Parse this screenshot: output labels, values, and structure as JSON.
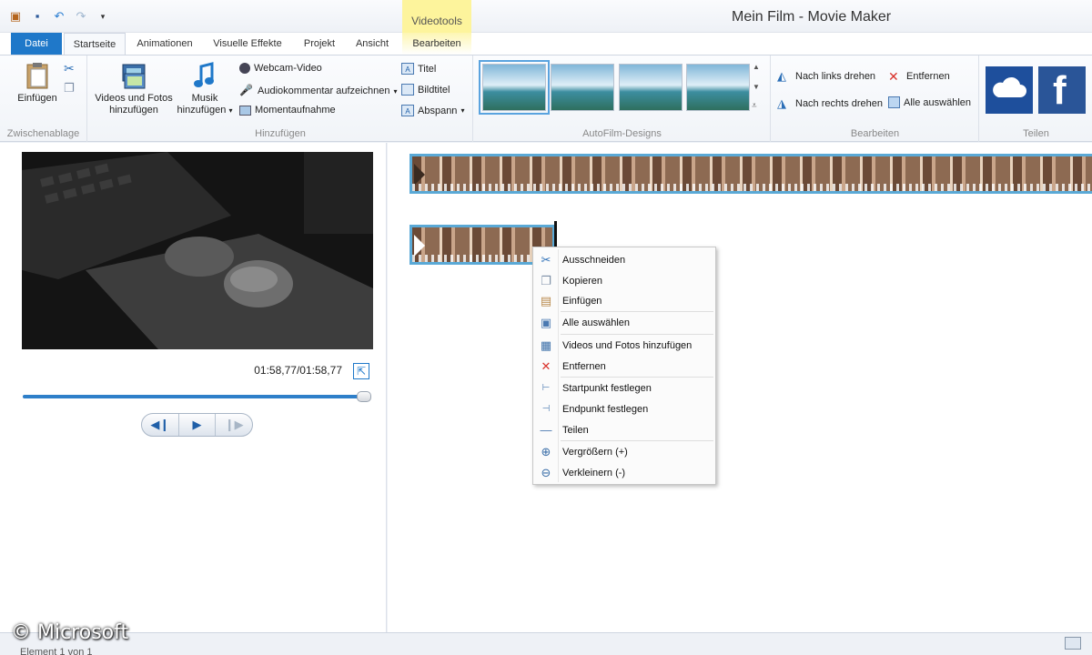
{
  "window": {
    "title": "Mein Film - Movie Maker",
    "context_group": "Videotools"
  },
  "tabs": [
    "Datei",
    "Startseite",
    "Animationen",
    "Visuelle Effekte",
    "Projekt",
    "Ansicht",
    "Bearbeiten"
  ],
  "ribbon": {
    "clipboard": {
      "paste": "Einfügen",
      "label": "Zwischenablage"
    },
    "add": {
      "videos_photos": [
        "Videos und Fotos",
        "hinzufügen"
      ],
      "music": [
        "Musik",
        "hinzufügen"
      ],
      "webcam": "Webcam-Video",
      "narration": "Audiokommentar aufzeichnen",
      "snapshot": "Momentaufnahme",
      "title": "Titel",
      "caption": "Bildtitel",
      "credits": "Abspann",
      "label": "Hinzufügen"
    },
    "themes": {
      "label": "AutoFilm-Designs"
    },
    "edit": {
      "rotate_left": "Nach links drehen",
      "rotate_right": "Nach rechts drehen",
      "remove": "Entfernen",
      "select_all": "Alle auswählen",
      "label": "Bearbeiten"
    },
    "share": {
      "label": "Teilen"
    }
  },
  "preview": {
    "time": "01:58,77/01:58,77",
    "progress": 1.0
  },
  "context_menu": [
    {
      "label": "Ausschneiden",
      "icon": "scissors-icon"
    },
    {
      "label": "Kopieren",
      "icon": "copy-icon"
    },
    {
      "label": "Einfügen",
      "icon": "paste-icon"
    },
    {
      "label": "Alle auswählen",
      "icon": "select-all-icon"
    },
    {
      "label": "Videos und Fotos hinzufügen",
      "icon": "add-media-icon"
    },
    {
      "label": "Entfernen",
      "icon": "remove-icon"
    },
    {
      "label": "Startpunkt festlegen",
      "icon": "start-point-icon"
    },
    {
      "label": "Endpunkt festlegen",
      "icon": "end-point-icon"
    },
    {
      "label": "Teilen",
      "icon": "split-icon"
    },
    {
      "label": "Vergrößern (+)",
      "icon": "zoom-in-icon"
    },
    {
      "label": "Verkleinern (-)",
      "icon": "zoom-out-icon"
    }
  ],
  "status": {
    "text": "Element 1 von 1",
    "watermark": "© Microsoft"
  },
  "colors": {
    "accent": "#1f78c9",
    "context": "#fdf49c",
    "selection": "#5aa9d6"
  }
}
